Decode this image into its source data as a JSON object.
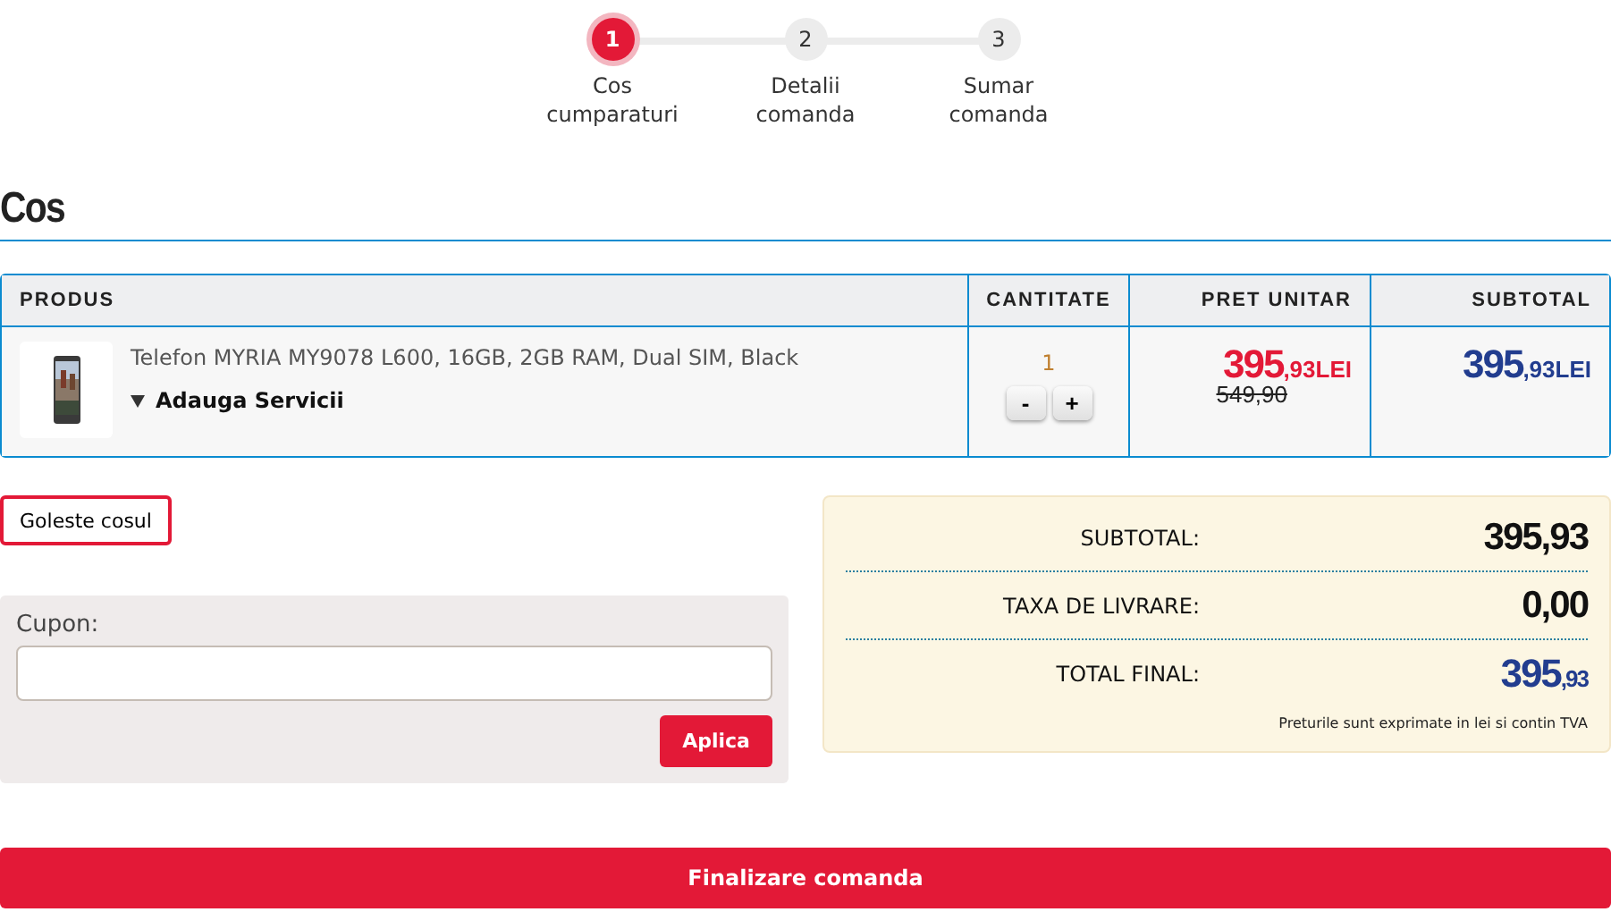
{
  "steps": [
    {
      "number": "1",
      "label": "Cos cumparaturi",
      "selected": true
    },
    {
      "number": "2",
      "label": "Detalii comanda",
      "selected": false
    },
    {
      "number": "3",
      "label": "Sumar comanda",
      "selected": false
    }
  ],
  "heading": "Cos",
  "table": {
    "columns": [
      "PRODUS",
      "CANTITATE",
      "PRET UNITAR",
      "SUBTOTAL"
    ],
    "rows": [
      {
        "product": {
          "kind": "picture",
          "name": "Telefon MYRIA MY9078 L600, 16GB, 2GB RAM, Dual SIM, Black",
          "services": "Adauga Servicii"
        },
        "quantity": "1",
        "minus": "-",
        "plus": "+",
        "unit_price": {
          "integer": "395",
          "decimals": ",93",
          "currency": "LEI"
        },
        "old_price": "549,90",
        "subtotal": {
          "integer": "395",
          "decimals": ",93",
          "currency": "LEI"
        }
      }
    ]
  },
  "empty_cart_button": "Goleste cosul",
  "coupon": {
    "label": "Cupon:",
    "button": "Aplica"
  },
  "summary": {
    "lines": [
      {
        "kind": "plain",
        "label": "SUBTOTAL:",
        "value": "395,93"
      },
      {
        "kind": "plain",
        "label": "TAXA DE LIVRARE:",
        "value": "0,00"
      },
      {
        "kind": "total",
        "label": "TOTAL FINAL:",
        "value": "395",
        "decimals": ",93"
      }
    ],
    "note": "Preturile sunt exprimate in lei si contin TVA"
  },
  "checkout_button": "Finalizare comanda"
}
